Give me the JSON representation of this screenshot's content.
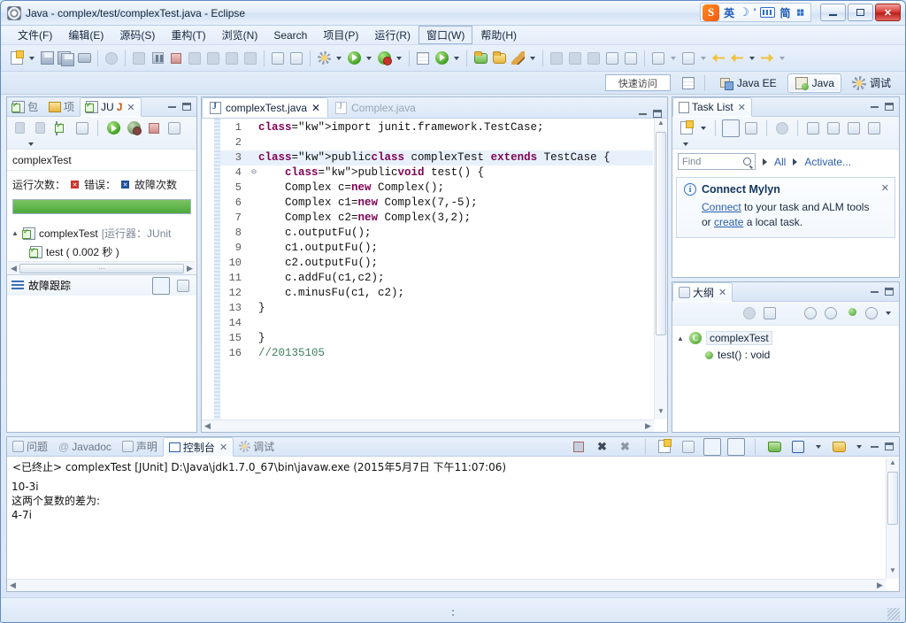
{
  "window": {
    "title": "Java - complex/test/complexTest.java - Eclipse",
    "app_icon": "eclipse-icon",
    "minimize_label": "Minimize",
    "maximize_label": "Maximize",
    "close_label": "✕"
  },
  "ime": {
    "logo": "S",
    "mode": "英",
    "moon": "☽",
    "comma": "'",
    "keyboard": "keyboard-icon",
    "simplified": "简",
    "tools": "wrench-icon"
  },
  "menubar": {
    "items": [
      {
        "label": "文件(F)",
        "name": "menu-file"
      },
      {
        "label": "编辑(E)",
        "name": "menu-edit"
      },
      {
        "label": "源码(S)",
        "name": "menu-source"
      },
      {
        "label": "重构(T)",
        "name": "menu-refactor"
      },
      {
        "label": "浏览(N)",
        "name": "menu-navigate"
      },
      {
        "label": "Search",
        "name": "menu-search"
      },
      {
        "label": "项目(P)",
        "name": "menu-project"
      },
      {
        "label": "运行(R)",
        "name": "menu-run"
      },
      {
        "label": "窗口(W)",
        "name": "menu-window",
        "boxed": true
      },
      {
        "label": "帮助(H)",
        "name": "menu-help"
      }
    ]
  },
  "perspective": {
    "quick_access": "快速访问",
    "open_perspective": "open-perspective-icon",
    "items": [
      {
        "label": "Java EE",
        "name": "perspective-java-ee",
        "active": false
      },
      {
        "label": "Java",
        "name": "perspective-java",
        "active": true
      },
      {
        "label": "调试",
        "name": "perspective-debug",
        "active": false
      }
    ]
  },
  "junit_view": {
    "tabs": [
      {
        "label": "包",
        "name": "tab-package-explorer",
        "active": false
      },
      {
        "label": "项",
        "name": "tab-project-explorer",
        "active": false
      },
      {
        "label": "JU",
        "name": "tab-junit",
        "active": true
      }
    ],
    "class_name": "complexTest",
    "counters": {
      "runs_label": "运行次数：",
      "errors_label": "错误：",
      "failures_label": "故障次数",
      "progress_percent": 100,
      "progress_color": "#4ca83a"
    },
    "tree": [
      {
        "label": "complexTest",
        "suffix": "[运行器：JUnit",
        "depth": 0,
        "expanded": true
      },
      {
        "label": "test ( 0.002 秒 )",
        "suffix": "",
        "depth": 1,
        "expanded": false
      }
    ],
    "failure_trace_label": "故障跟踪"
  },
  "editor": {
    "tabs": [
      {
        "label": "complexTest.java",
        "name": "editor-tab-complexTest",
        "active": true,
        "closable": true
      },
      {
        "label": "Complex.java",
        "name": "editor-tab-Complex",
        "active": false,
        "closable": false
      }
    ],
    "lines": [
      {
        "n": "1",
        "fold": "",
        "text": "import junit.framework.TestCase;",
        "kind": "import"
      },
      {
        "n": "2",
        "fold": "",
        "text": "",
        "kind": "plain"
      },
      {
        "n": "3",
        "fold": "",
        "text": "public class complexTest extends TestCase {",
        "kind": "class",
        "highlight": true
      },
      {
        "n": "4",
        "fold": "⊖",
        "text": "    public void test() {",
        "kind": "method"
      },
      {
        "n": "5",
        "fold": "",
        "text": "    Complex c=new Complex();",
        "kind": "stmt"
      },
      {
        "n": "6",
        "fold": "",
        "text": "    Complex c1=new Complex(7,-5);",
        "kind": "stmt"
      },
      {
        "n": "7",
        "fold": "",
        "text": "    Complex c2=new Complex(3,2);",
        "kind": "stmt"
      },
      {
        "n": "8",
        "fold": "",
        "text": "    c.outputFu();",
        "kind": "plain"
      },
      {
        "n": "9",
        "fold": "",
        "text": "    c1.outputFu();",
        "kind": "plain"
      },
      {
        "n": "10",
        "fold": "",
        "text": "    c2.outputFu();",
        "kind": "plain"
      },
      {
        "n": "11",
        "fold": "",
        "text": "    c.addFu(c1,c2);",
        "kind": "plain"
      },
      {
        "n": "12",
        "fold": "",
        "text": "    c.minusFu(c1, c2);",
        "kind": "plain"
      },
      {
        "n": "13",
        "fold": "",
        "text": "}",
        "kind": "plain"
      },
      {
        "n": "14",
        "fold": "",
        "text": "",
        "kind": "plain"
      },
      {
        "n": "15",
        "fold": "",
        "text": "}",
        "kind": "plain"
      },
      {
        "n": "16",
        "fold": "",
        "text": "//20135105",
        "kind": "comment"
      }
    ]
  },
  "task_list": {
    "tab_label": "Task List",
    "find_placeholder": "Find",
    "filter_all": "All",
    "activate_link": "Activate...",
    "mylyn": {
      "title": "Connect Mylyn",
      "line1_link": "Connect",
      "line1_rest": " to your task and ALM tools",
      "line2_pre": "or ",
      "line2_link": "create",
      "line2_rest": " a local task.",
      "close": "✕"
    }
  },
  "outline": {
    "tab_label": "大纲",
    "items": [
      {
        "label": "complexTest",
        "type": "class",
        "depth": 0,
        "selected": true
      },
      {
        "label": "test() : void",
        "type": "method",
        "depth": 1,
        "selected": false
      }
    ]
  },
  "console": {
    "tabs": [
      {
        "label": "问题",
        "name": "tab-problems",
        "active": false
      },
      {
        "label": "Javadoc",
        "name": "tab-javadoc",
        "active": false
      },
      {
        "label": "声明",
        "name": "tab-declaration",
        "active": false
      },
      {
        "label": "控制台",
        "name": "tab-console",
        "active": true
      },
      {
        "label": "调试",
        "name": "tab-debug",
        "active": false
      }
    ],
    "header": "<已终止> complexTest [JUnit] D:\\Java\\jdk1.7.0_67\\bin\\javaw.exe (2015年5月7日 下午11:07:06)",
    "output": "10-3i\n这两个复数的差为:\n4-7i"
  },
  "colors": {
    "accent": "#2a5db0",
    "keyword": "#7f0055",
    "comment": "#3f7f5f",
    "progress_green": "#4ca83a",
    "error_red": "#c8342c",
    "failure_blue": "#1e4f9c"
  }
}
